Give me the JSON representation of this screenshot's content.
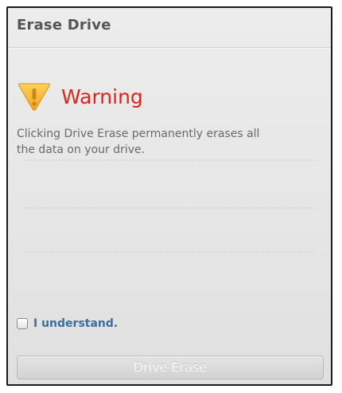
{
  "dialog": {
    "title": "Erase Drive"
  },
  "warning": {
    "icon": "warning-icon",
    "title": "Warning",
    "message": "Clicking Drive Erase permanently erases all the data on your drive."
  },
  "confirm": {
    "checked": false,
    "label": "I understand."
  },
  "actions": {
    "erase_label": "Drive Erase",
    "erase_enabled": false
  },
  "colors": {
    "warning_text": "#e3221b",
    "link_text": "#3c6fa0",
    "icon_fill": "#f2b13a"
  }
}
